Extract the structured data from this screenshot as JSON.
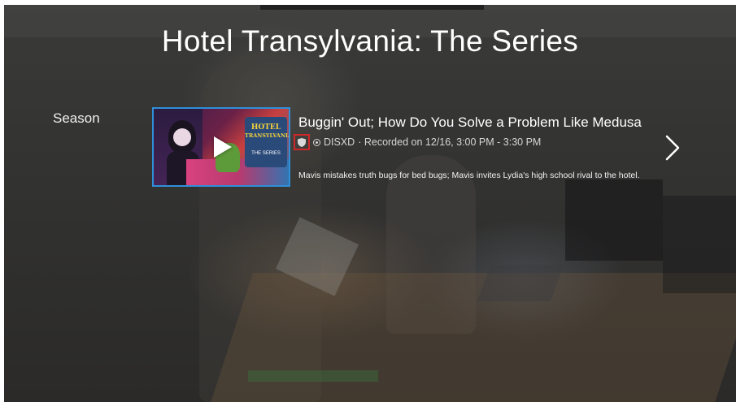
{
  "show": {
    "title": "Hotel Transylvania: The Series"
  },
  "season": {
    "label": "Season"
  },
  "episode": {
    "title": "Buggin' Out; How Do You Solve a Problem Like Medusa",
    "channel": "DISXD",
    "recorded": "· Recorded on 12/16, 3:00 PM - 3:30 PM",
    "description": "Mavis mistakes truth bugs for bed bugs; Mavis invites Lydia's high school rival to the hotel.",
    "thumbnail_logo_line1": "HOTEL",
    "thumbnail_logo_line2": "TRANSYLVANIA",
    "thumbnail_logo_sub": "THE SERIES"
  },
  "icons": {
    "play": "play-icon",
    "rating": "shield-icon",
    "channel": "record-dot-icon",
    "next": "chevron-right-icon"
  },
  "colors": {
    "selection_border": "#2f8fd9",
    "highlight_box": "#d0282a",
    "background": "#333231"
  }
}
